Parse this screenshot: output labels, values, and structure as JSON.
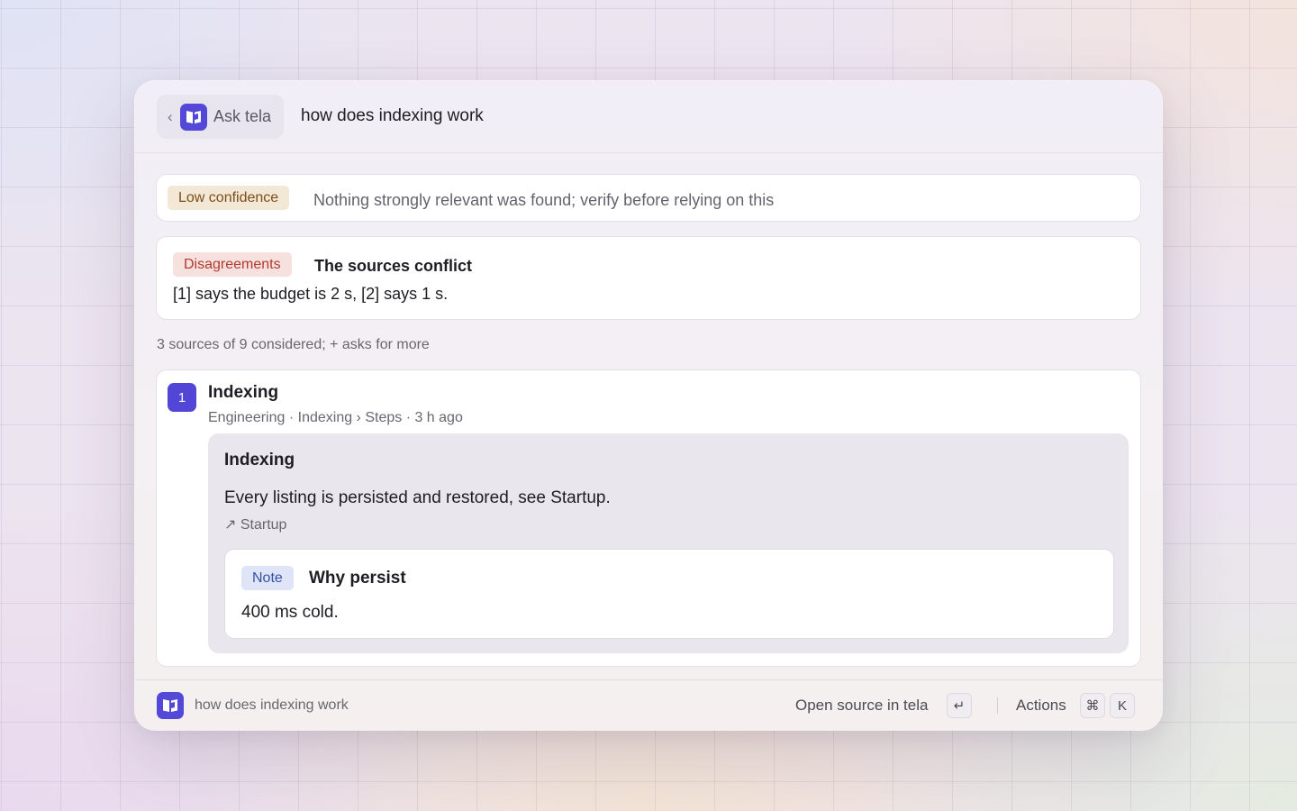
{
  "header": {
    "back_label": "Ask tela",
    "query": "how does indexing work"
  },
  "confidence": {
    "badge": "Low confidence",
    "message": "Nothing strongly relevant was found; verify before relying on this"
  },
  "disagreements": {
    "badge": "Disagreements",
    "title": "The sources conflict",
    "body": "[1] says the budget is 2 s, [2] says 1 s."
  },
  "considered": "3 sources of 9 considered; + asks for more",
  "source": {
    "number": "1",
    "title": "Indexing",
    "meta": "Engineering · Indexing › Steps · 3 h ago",
    "section_title": "Indexing",
    "body": "Every listing is persisted and restored, see Startup.",
    "link": "↗ Startup",
    "note": {
      "badge": "Note",
      "title": "Why persist",
      "body": "400 ms cold."
    }
  },
  "footer": {
    "query": "how does indexing work",
    "open_action": "Open source in tela",
    "open_key": "↵",
    "actions_label": "Actions",
    "actions_keys": [
      "⌘",
      "K"
    ]
  },
  "colors": {
    "accent": "#5448d9",
    "low_confidence_bg": "#f3e7d6",
    "disagreement_bg": "#f7e1df",
    "note_bg": "#dfe5f7"
  }
}
